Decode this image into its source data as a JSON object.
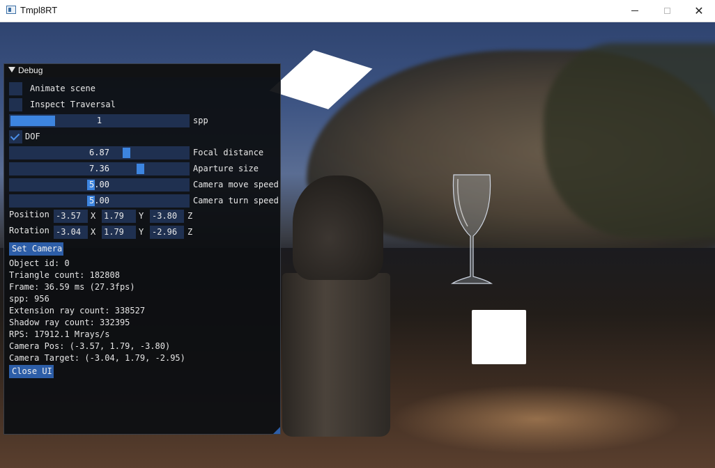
{
  "window": {
    "title": "Tmpl8RT",
    "close_glyph": "✕"
  },
  "debug": {
    "title": "Debug",
    "animate_scene": {
      "label": "Animate scene",
      "checked": false
    },
    "inspect_traversal": {
      "label": "Inspect Traversal",
      "checked": false
    },
    "spp_slider": {
      "value": "1",
      "label": "spp",
      "fraction": 0.25
    },
    "dof": {
      "label": "DOF",
      "checked": true
    },
    "focal_distance": {
      "value": "6.87",
      "label": "Focal distance",
      "fraction": 0.66
    },
    "aperture_size": {
      "value": "7.36",
      "label": "Aparture size",
      "fraction": 0.74
    },
    "camera_move_speed": {
      "value": "5.00",
      "label": "Camera move speed",
      "fraction": 0.45
    },
    "camera_turn_speed": {
      "value": "5.00",
      "label": "Camera turn speed",
      "fraction": 0.45
    },
    "position": {
      "label": "Position",
      "x": "-3.57",
      "y": "1.79",
      "z": "-3.80"
    },
    "rotation": {
      "label": "Rotation",
      "x": "-3.04",
      "y": "1.79",
      "z": "-2.96"
    },
    "axes": {
      "x": "X",
      "y": "Y",
      "z": "Z"
    },
    "set_camera_label": "Set Camera",
    "stats": {
      "object_id": "Object id: 0",
      "triangle_count": "Triangle count: 182808",
      "frame": "Frame: 36.59 ms (27.3fps)",
      "spp": "spp: 956",
      "extension_rays": "Extension ray count: 338527",
      "shadow_rays": "Shadow ray count: 332395",
      "rps": "RPS: 17912.1 Mrays/s",
      "camera_pos": "Camera Pos: (-3.57, 1.79, -3.80)",
      "camera_target": "Camera Target: (-3.04, 1.79, -2.95)"
    },
    "close_ui_label": "Close UI"
  },
  "colors": {
    "accent": "#3d85e0",
    "frame_bg": "#1f3050",
    "button": "#2d5ea8",
    "panel_bg": "#0d0f12"
  }
}
